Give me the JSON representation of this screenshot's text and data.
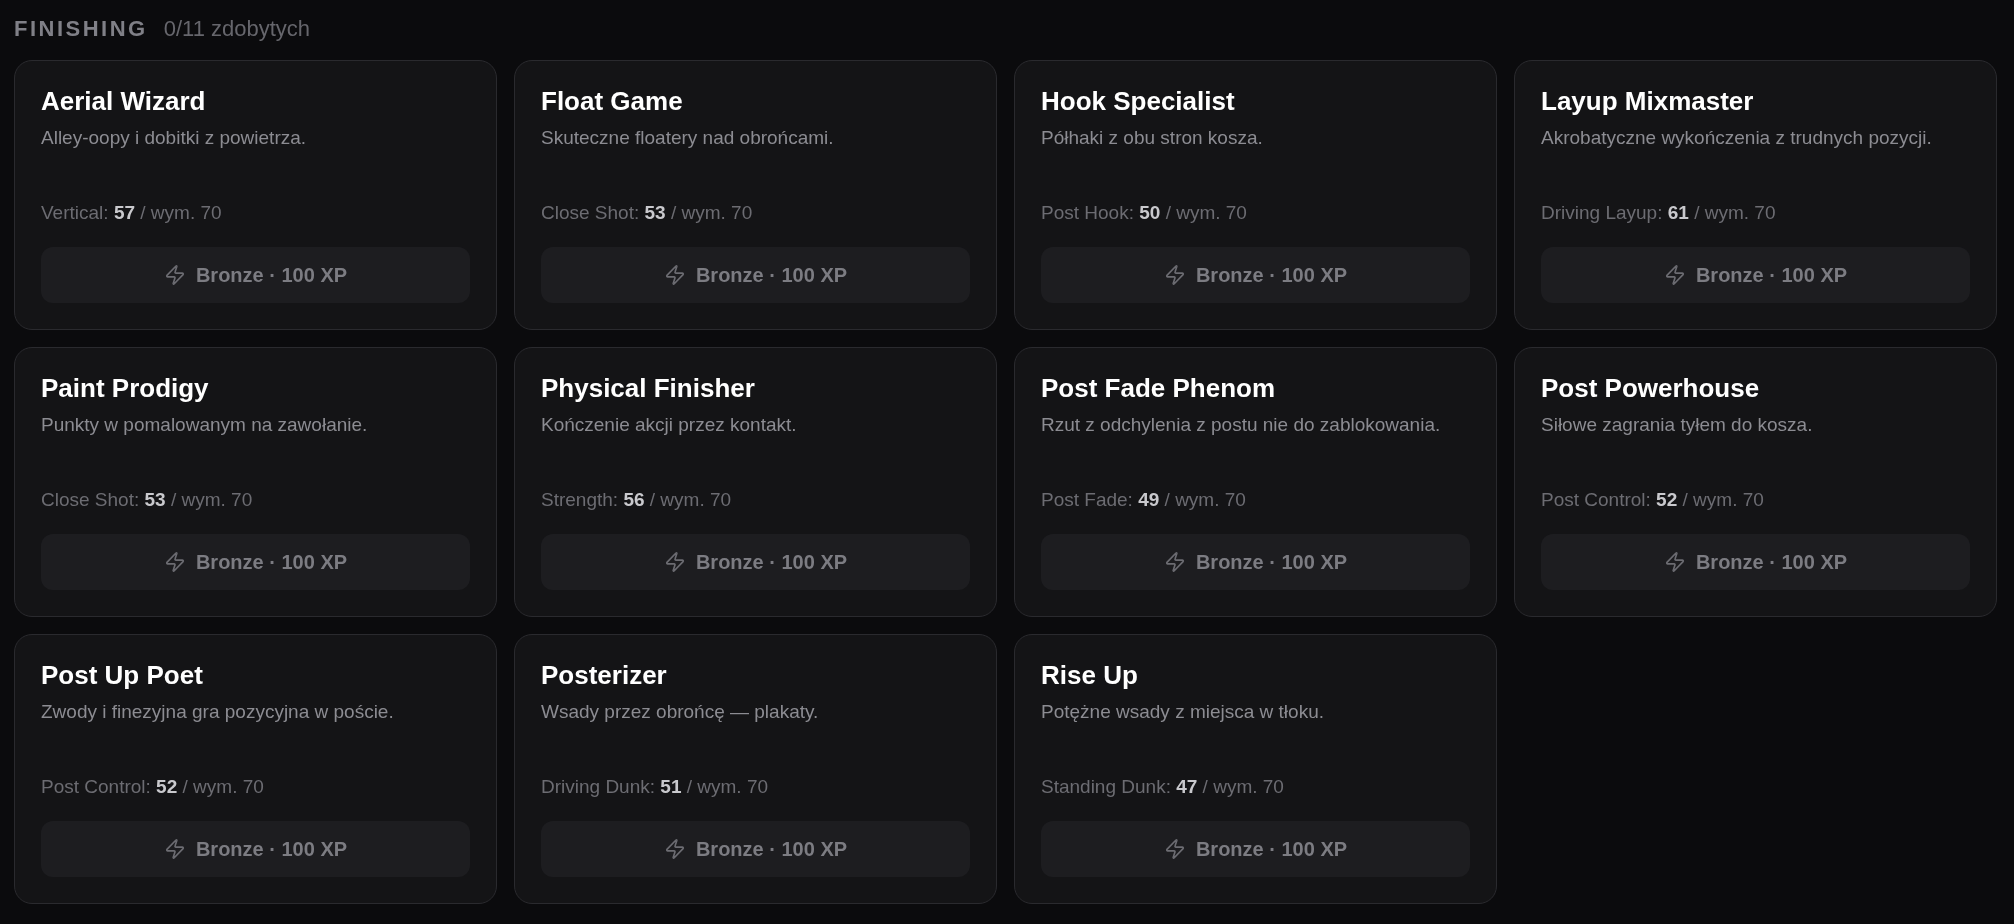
{
  "section": {
    "title": "FINISHING",
    "progress": "0/11 zdobytych"
  },
  "badges": [
    {
      "name": "Aerial Wizard",
      "description": "Alley-oopy i dobitki z powietrza.",
      "stat": "Vertical: **57** / wym. 70",
      "reward": "Bronze · 100 XP"
    },
    {
      "name": "Float Game",
      "description": "Skuteczne floatery nad obrońcami.",
      "stat": "Close Shot: **53** / wym. 70",
      "reward": "Bronze · 100 XP"
    },
    {
      "name": "Hook Specialist",
      "description": "Półhaki z obu stron kosza.",
      "stat": "Post Hook: **50** / wym. 70",
      "reward": "Bronze · 100 XP"
    },
    {
      "name": "Layup Mixmaster",
      "description": "Akrobatyczne wykończenia z trudnych pozycji.",
      "stat": "Driving Layup: **61** / wym. 70",
      "reward": "Bronze · 100 XP"
    },
    {
      "name": "Paint Prodigy",
      "description": "Punkty w pomalowanym na zawołanie.",
      "stat": "Close Shot: **53** / wym. 70",
      "reward": "Bronze · 100 XP"
    },
    {
      "name": "Physical Finisher",
      "description": "Kończenie akcji przez kontakt.",
      "stat": "Strength: **56** / wym. 70",
      "reward": "Bronze · 100 XP"
    },
    {
      "name": "Post Fade Phenom",
      "description": "Rzut z odchylenia z postu nie do zablokowania.",
      "stat": "Post Fade: **49** / wym. 70",
      "reward": "Bronze · 100 XP"
    },
    {
      "name": "Post Powerhouse",
      "description": "Siłowe zagrania tyłem do kosza.",
      "stat": "Post Control: **52** / wym. 70",
      "reward": "Bronze · 100 XP"
    },
    {
      "name": "Post Up Poet",
      "description": "Zwody i finezyjna gra pozycyjna w poście.",
      "stat": "Post Control: **52** / wym. 70",
      "reward": "Bronze · 100 XP"
    },
    {
      "name": "Posterizer",
      "description": "Wsady przez obrońcę — plakaty.",
      "stat": "Driving Dunk: **51** / wym. 70",
      "reward": "Bronze · 100 XP"
    },
    {
      "name": "Rise Up",
      "description": "Potężne wsady z miejsca w tłoku.",
      "stat": "Standing Dunk: **47** / wym. 70",
      "reward": "Bronze · 100 XP"
    }
  ]
}
